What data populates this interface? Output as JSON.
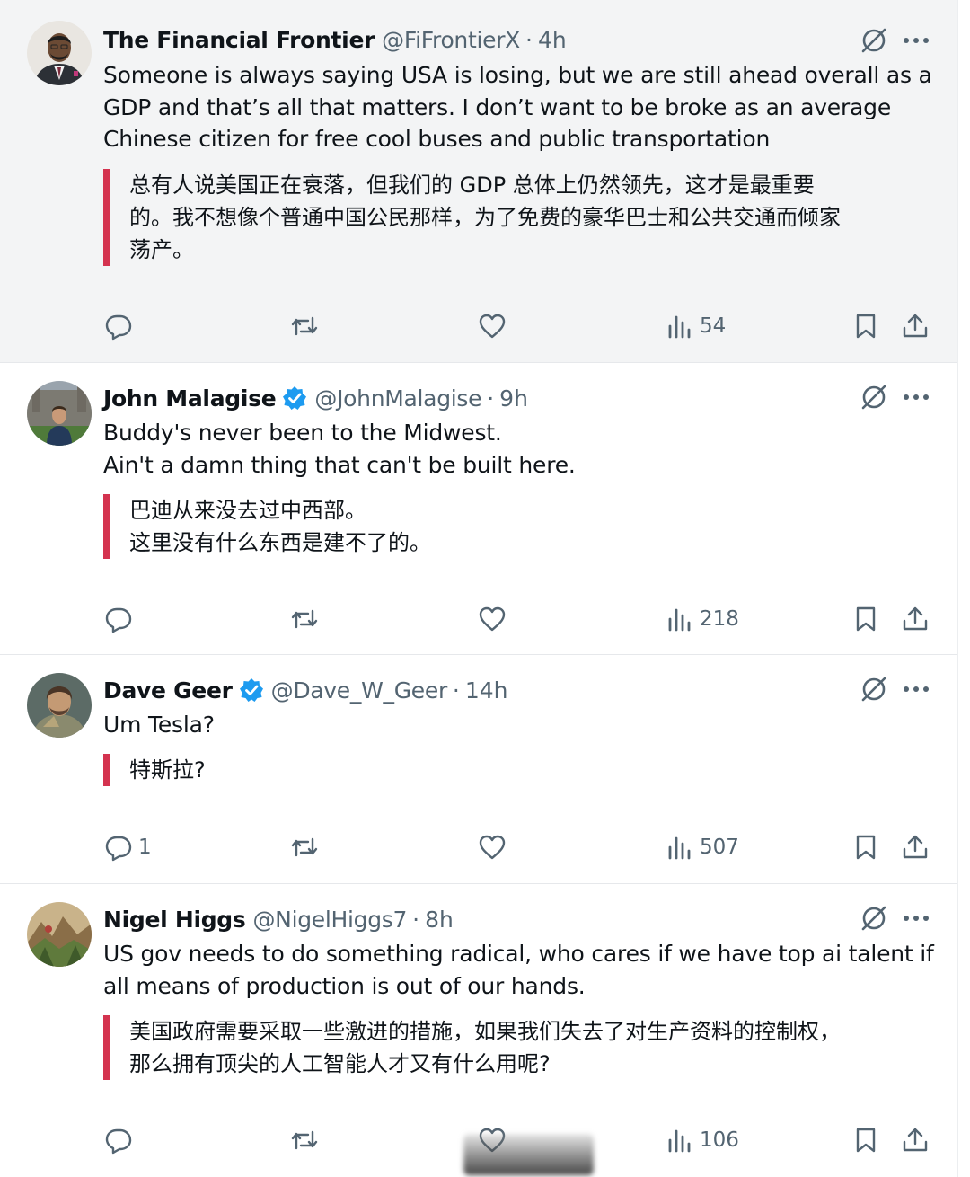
{
  "colors": {
    "accent_bar": "#d4334f",
    "verified_blue": "#1d9bf0",
    "secondary_text": "#536471",
    "highlight_bg": "#f3f4f5"
  },
  "tweets": [
    {
      "name": "The Financial Frontier",
      "handle": "@FiFrontierX",
      "separator": "·",
      "time": "4h",
      "verified": false,
      "avatar_icon": "avatar-man-suit",
      "text_lines": [
        "Someone is always saying USA is losing, but we are still ahead overall as a",
        "GDP and that’s all that matters. I don’t want to be broke as an average",
        "Chinese citizen for free cool buses and public transportation"
      ],
      "translation_lines": [
        "总有人说美国正在衰落，但我们的 GDP 总体上仍然领先，这才是最重要",
        "的。我不想像个普通中国公民那样，为了免费的豪华巴士和公共交通而倾家",
        "荡产。"
      ],
      "replies": "",
      "retweets": "",
      "likes": "",
      "views": "54"
    },
    {
      "name": "John Malagise",
      "handle": "@JohnMalagise",
      "separator": "·",
      "time": "9h",
      "verified": true,
      "avatar_icon": "avatar-man-campus",
      "text_lines": [
        "Buddy's never been to the Midwest.",
        "Ain't a damn thing that can't be built here."
      ],
      "translation_lines": [
        "巴迪从来没去过中西部。",
        "这里没有什么东西是建不了的。"
      ],
      "replies": "",
      "retweets": "",
      "likes": "",
      "views": "218"
    },
    {
      "name": "Dave Geer",
      "handle": "@Dave_W_Geer",
      "separator": "·",
      "time": "14h",
      "verified": true,
      "avatar_icon": "avatar-warrior",
      "text_lines": [
        "Um Tesla?"
      ],
      "translation_lines": [
        "特斯拉?"
      ],
      "replies": "1",
      "retweets": "",
      "likes": "",
      "views": "507"
    },
    {
      "name": "Nigel Higgs",
      "handle": "@NigelHiggs7",
      "separator": "·",
      "time": "8h",
      "verified": false,
      "avatar_icon": "avatar-landscape",
      "text_lines": [
        "US gov needs to do something radical, who cares if we have top ai talent if",
        "all means of production is out of our hands."
      ],
      "translation_lines": [
        "美国政府需要采取一些激进的措施，如果我们失去了对生产资料的控制权，",
        "那么拥有顶尖的人工智能人才又有什么用呢?"
      ],
      "replies": "",
      "retweets": "",
      "likes": "",
      "views": "106"
    }
  ],
  "icons": {
    "reply": "reply-icon",
    "retweet": "retweet-icon",
    "like": "heart-icon",
    "views": "views-chart-icon",
    "bookmark": "bookmark-icon",
    "share": "share-icon",
    "grok": "grok-icon",
    "more": "more-dots-icon",
    "verified": "verified-badge-icon"
  }
}
